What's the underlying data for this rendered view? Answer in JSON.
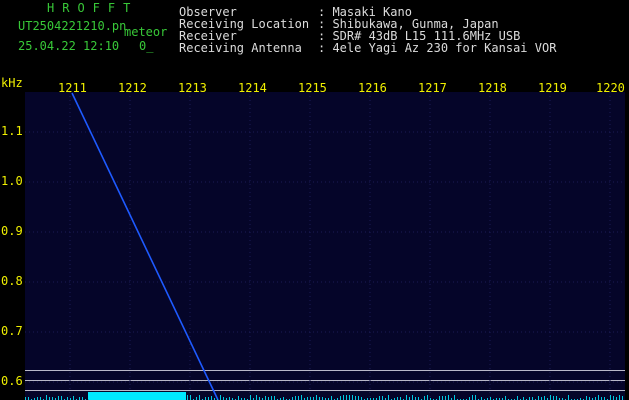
{
  "header": {
    "app_title": "HROFFT",
    "filename": "UT2504221210.pn",
    "type": "meteor",
    "datetime": "25.04.22 12:10",
    "count": "0_"
  },
  "info": [
    {
      "label": "Observer",
      "value": ": Masaki Kano"
    },
    {
      "label": "Receiving Location",
      "value": ": Shibukawa, Gunma, Japan"
    },
    {
      "label": "Receiver",
      "value": ": SDR# 43dB L15 111.6MHz USB"
    },
    {
      "label": "Receiving Antenna",
      "value": ": 4ele Yagi Az 230 for Kansai VOR"
    }
  ],
  "axis": {
    "y_unit": "kHz",
    "x_ticks": [
      "1211",
      "1212",
      "1213",
      "1214",
      "1215",
      "1216",
      "1217",
      "1218",
      "1219",
      "1220"
    ],
    "y_ticks": [
      "1.1",
      "1.0",
      "0.9",
      "0.8",
      "0.7",
      "0.6"
    ]
  },
  "colors": {
    "title_green": "#38c838",
    "label_white": "#dcdcdc",
    "axis_yellow": "#f0f000",
    "plot_bg": "#050529",
    "trace_blue": "#1e5aff",
    "signal_cyan": "#00e8ff"
  }
}
